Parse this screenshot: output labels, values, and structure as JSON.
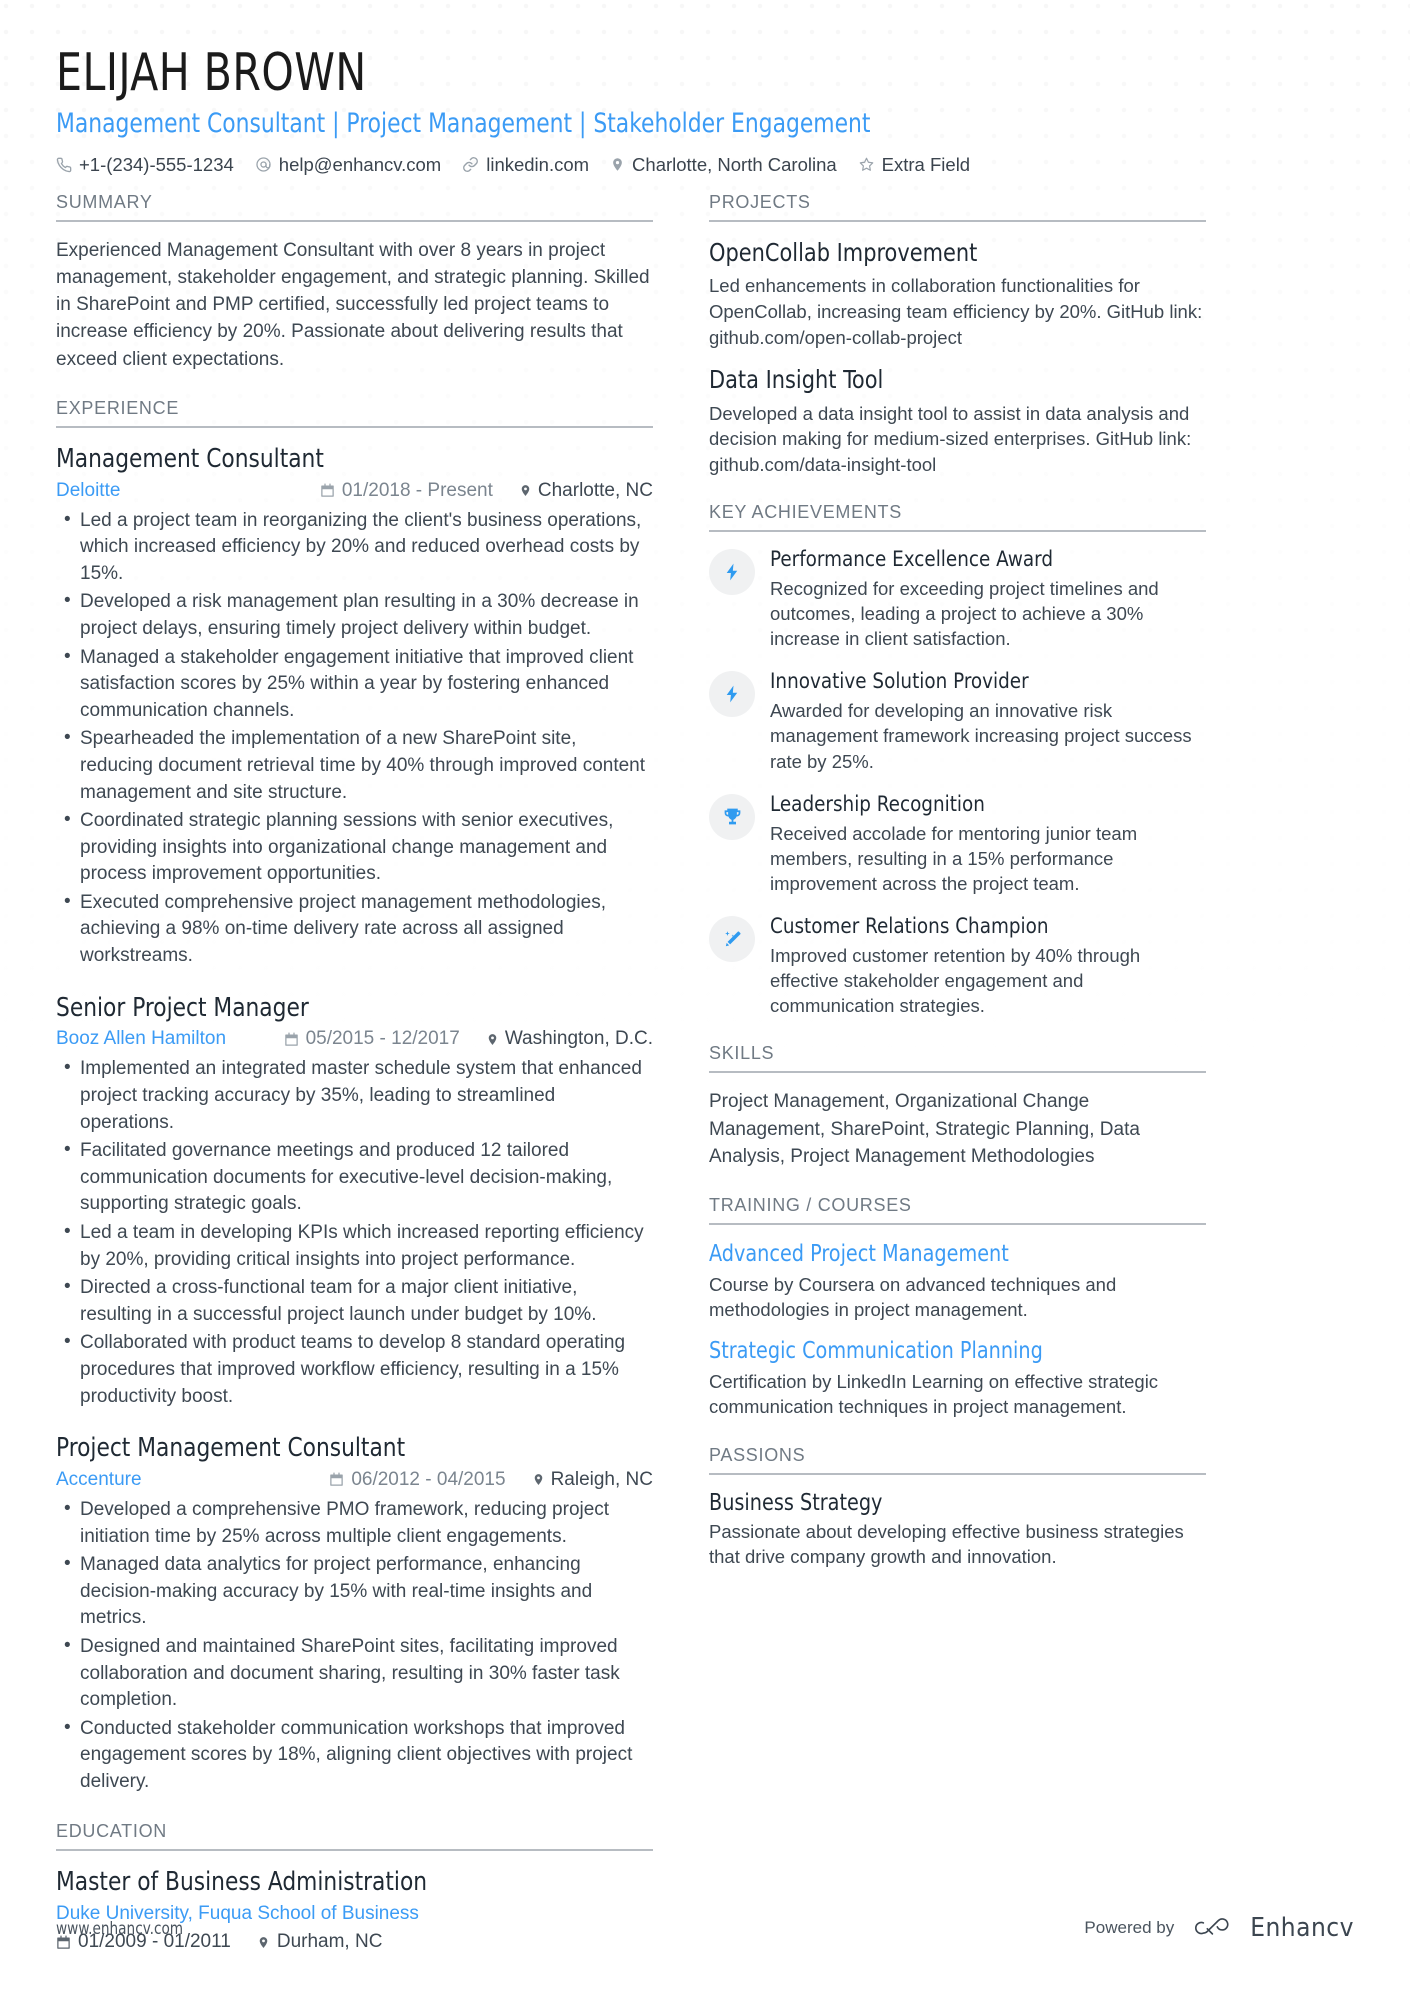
{
  "header": {
    "name": "ELIJAH BROWN",
    "headline": "Management Consultant | Project Management | Stakeholder Engagement",
    "contacts": [
      {
        "icon": "phone-icon",
        "text": "+1-(234)-555-1234"
      },
      {
        "icon": "email-icon",
        "text": "help@enhancv.com"
      },
      {
        "icon": "link-icon",
        "text": "linkedin.com"
      },
      {
        "icon": "location-pin-icon",
        "text": "Charlotte, North Carolina"
      },
      {
        "icon": "star-icon",
        "text": "Extra Field"
      }
    ]
  },
  "sections": {
    "summary_title": "SUMMARY",
    "experience_title": "EXPERIENCE",
    "education_title": "EDUCATION",
    "projects_title": "PROJECTS",
    "achievements_title": "KEY ACHIEVEMENTS",
    "skills_title": "SKILLS",
    "training_title": "TRAINING / COURSES",
    "passions_title": "PASSIONS"
  },
  "summary": {
    "text": "Experienced Management Consultant with over 8 years in project management, stakeholder engagement, and strategic planning. Skilled in SharePoint and PMP certified, successfully led project teams to increase efficiency by 20%. Passionate about delivering results that exceed client expectations."
  },
  "experience": [
    {
      "title": "Management Consultant",
      "company": "Deloitte",
      "date": "01/2018 - Present",
      "location": "Charlotte, NC",
      "bullets": [
        "Led a project team in reorganizing the client's business operations, which increased efficiency by 20% and reduced overhead costs by 15%.",
        "Developed a risk management plan resulting in a 30% decrease in project delays, ensuring timely project delivery within budget.",
        "Managed a stakeholder engagement initiative that improved client satisfaction scores by 25% within a year by fostering enhanced communication channels.",
        "Spearheaded the implementation of a new SharePoint site, reducing document retrieval time by 40% through improved content management and site structure.",
        "Coordinated strategic planning sessions with senior executives, providing insights into organizational change management and process improvement opportunities.",
        "Executed comprehensive project management methodologies, achieving a 98% on-time delivery rate across all assigned workstreams."
      ]
    },
    {
      "title": "Senior Project Manager",
      "company": "Booz Allen Hamilton",
      "date": "05/2015 - 12/2017",
      "location": "Washington, D.C.",
      "bullets": [
        "Implemented an integrated master schedule system that enhanced project tracking accuracy by 35%, leading to streamlined operations.",
        "Facilitated governance meetings and produced 12 tailored communication documents for executive-level decision-making, supporting strategic goals.",
        "Led a team in developing KPIs which increased reporting efficiency by 20%, providing critical insights into project performance.",
        "Directed a cross-functional team for a major client initiative, resulting in a successful project launch under budget by 10%.",
        "Collaborated with product teams to develop 8 standard operating procedures that improved workflow efficiency, resulting in a 15% productivity boost."
      ]
    },
    {
      "title": "Project Management Consultant",
      "company": "Accenture",
      "date": "06/2012 - 04/2015",
      "location": "Raleigh, NC",
      "bullets": [
        "Developed a comprehensive PMO framework, reducing project initiation time by 25% across multiple client engagements.",
        "Managed data analytics for project performance, enhancing decision-making accuracy by 15% with real-time insights and metrics.",
        "Designed and maintained SharePoint sites, facilitating improved collaboration and document sharing, resulting in 30% faster task completion.",
        "Conducted stakeholder communication workshops that improved engagement scores by 18%, aligning client objectives with project delivery."
      ]
    }
  ],
  "education": [
    {
      "degree": "Master of Business Administration",
      "school": "Duke University, Fuqua School of Business",
      "date": "01/2009 - 01/2011",
      "location": "Durham, NC"
    }
  ],
  "projects": [
    {
      "title": "OpenCollab Improvement",
      "description": "Led enhancements in collaboration functionalities for OpenCollab, increasing team efficiency by 20%. GitHub link: github.com/open-collab-project"
    },
    {
      "title": "Data Insight Tool",
      "description": "Developed a data insight tool to assist in data analysis and decision making for medium-sized enterprises. GitHub link: github.com/data-insight-tool"
    }
  ],
  "achievements": [
    {
      "icon": "lightning-bolt-icon",
      "title": "Performance Excellence Award",
      "description": "Recognized for exceeding project timelines and outcomes, leading a project to achieve a 30% increase in client satisfaction."
    },
    {
      "icon": "lightning-bolt-icon",
      "title": "Innovative Solution Provider",
      "description": "Awarded for developing an innovative risk management framework increasing project success rate by 25%."
    },
    {
      "icon": "trophy-icon",
      "title": "Leadership Recognition",
      "description": "Received accolade for mentoring junior team members, resulting in a 15% performance improvement across the project team."
    },
    {
      "icon": "magic-wand-icon",
      "title": "Customer Relations Champion",
      "description": "Improved customer retention by 40% through effective stakeholder engagement and communication strategies."
    }
  ],
  "skills": {
    "text": "Project Management, Organizational Change Management, SharePoint, Strategic Planning, Data Analysis, Project Management Methodologies"
  },
  "training": [
    {
      "title": "Advanced Project Management",
      "description": "Course by Coursera on advanced techniques and methodologies in project management."
    },
    {
      "title": "Strategic Communication Planning",
      "description": "Certification by LinkedIn Learning on effective strategic communication techniques in project management."
    }
  ],
  "passions": [
    {
      "title": "Business Strategy",
      "description": "Passionate about developing effective business strategies that drive company growth and innovation."
    }
  ],
  "footer": {
    "url": "www.enhancv.com",
    "powered_by": "Powered by",
    "brand": "Enhancv"
  },
  "colors": {
    "accent_blue": "#3b9bf5",
    "text_dark": "#1f2933",
    "text_body": "#3e4852",
    "section_header": "#707a84",
    "rule": "#b7bcc2",
    "badge_bg": "#f0f1f2"
  }
}
